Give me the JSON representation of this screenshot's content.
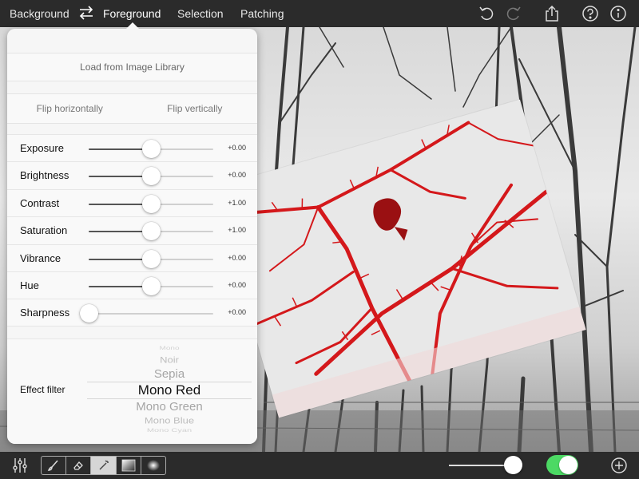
{
  "topbar": {
    "tabs": [
      {
        "label": "Background",
        "active": false
      },
      {
        "label": "Foreground",
        "active": true
      },
      {
        "label": "Selection",
        "active": false
      },
      {
        "label": "Patching",
        "active": false
      }
    ],
    "icons": [
      "swap-icon",
      "undo-icon",
      "redo-icon",
      "share-icon",
      "help-icon",
      "info-icon"
    ]
  },
  "panel": {
    "load_label": "Load from Image Library",
    "flip_horizontal_label": "Flip horizontally",
    "flip_vertical_label": "Flip vertically",
    "sliders": [
      {
        "label": "Exposure",
        "value": "+0.00",
        "level": 0.5
      },
      {
        "label": "Brightness",
        "value": "+0.00",
        "level": 0.5
      },
      {
        "label": "Contrast",
        "value": "+1.00",
        "level": 0.5
      },
      {
        "label": "Saturation",
        "value": "+1.00",
        "level": 0.5
      },
      {
        "label": "Vibrance",
        "value": "+0.00",
        "level": 0.5
      },
      {
        "label": "Hue",
        "value": "+0.00",
        "level": 0.5
      },
      {
        "label": "Sharpness",
        "value": "+0.00",
        "level": 0.0
      }
    ],
    "filter": {
      "label": "Effect filter",
      "options": [
        "Mono",
        "Noir",
        "Sepia",
        "Mono Red",
        "Mono Green",
        "Mono Blue",
        "Mono Cyan"
      ],
      "selected": "Mono Red"
    }
  },
  "bottombar": {
    "tools": [
      "brush-icon",
      "eraser-icon",
      "magic-wand-icon",
      "gradient-icon",
      "radial-gradient-icon"
    ],
    "selected_tool": "magic-wand-icon",
    "brush_size_level": 1.0,
    "toggle_on": true
  },
  "colors": {
    "bar": "#2b2b2b",
    "toggle_on": "#4cd964",
    "accent_red": "#d4181b"
  }
}
